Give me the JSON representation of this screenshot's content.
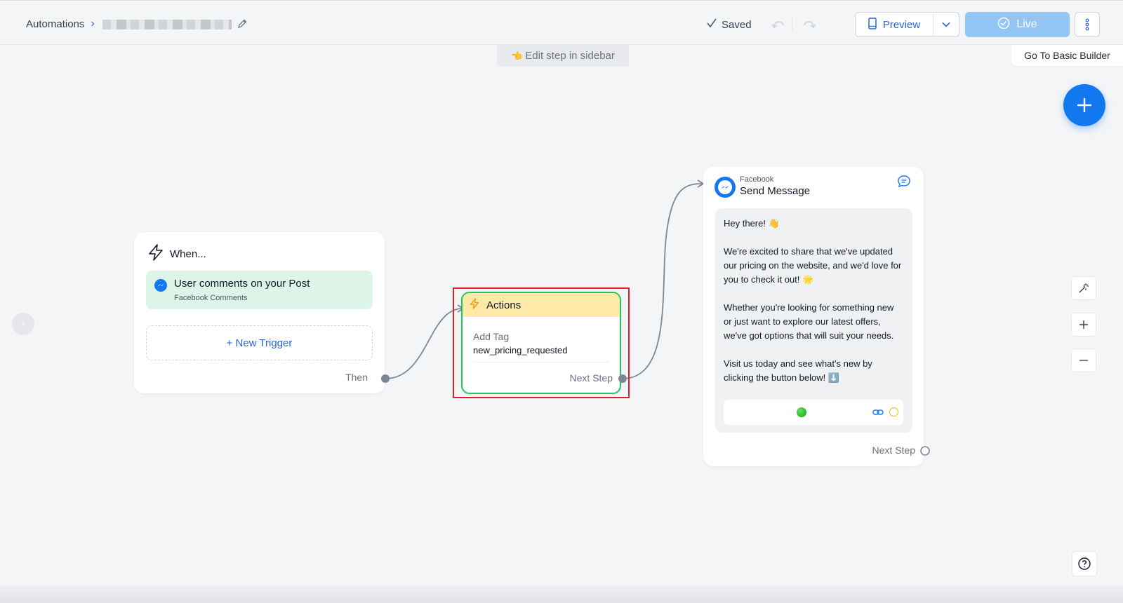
{
  "header": {
    "breadcrumb_root": "Automations",
    "saved_label": "Saved",
    "preview_label": "Preview",
    "live_label": "Live"
  },
  "canvas": {
    "edit_hint": "Edit step in sidebar",
    "basic_builder_label": "Go To Basic Builder"
  },
  "trigger_card": {
    "title": "When...",
    "trigger": {
      "title": "User comments on your Post",
      "subtitle": "Facebook Comments"
    },
    "new_trigger_label": "+ New Trigger",
    "then_label": "Then"
  },
  "actions_card": {
    "title": "Actions",
    "action_label": "Add Tag",
    "action_value": "new_pricing_requested",
    "next_label": "Next Step"
  },
  "message_card": {
    "platform": "Facebook",
    "title": "Send Message",
    "paragraphs": [
      "Hey there! 👋",
      "We're excited to share that we've updated our pricing on the website, and we'd love for you to check it out! 🌟",
      "Whether you're looking for something new or just want to explore our latest offers, we've got options that will suit your needs.",
      "Visit us today and see what's new by clicking the button below! ⬇️"
    ],
    "next_label": "Next Step"
  },
  "colors": {
    "accent": "#1178f0",
    "live_button": "#93c5f5",
    "trigger_bg": "#dcf5e8",
    "actions_header": "#fde9a8",
    "actions_border": "#22c55e",
    "highlight": "#e11d27"
  }
}
